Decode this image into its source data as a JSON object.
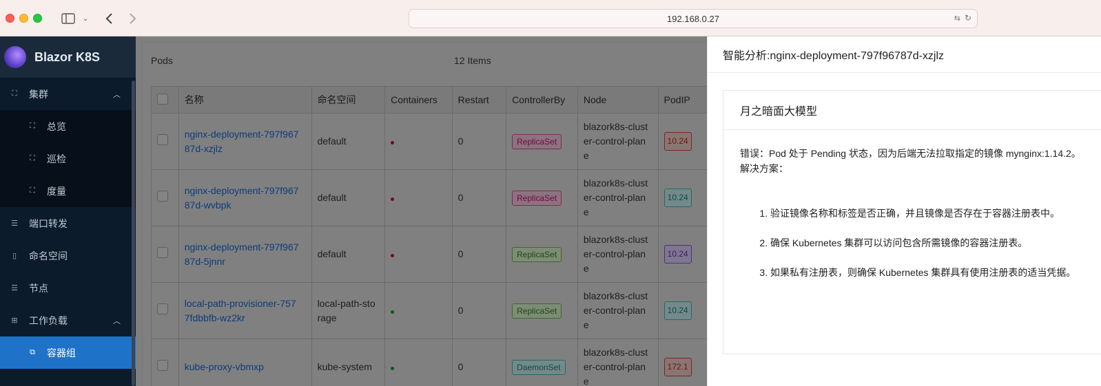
{
  "browser": {
    "url": "192.168.0.27"
  },
  "sidebar": {
    "brand": "Blazor K8S",
    "items": [
      {
        "label": "集群",
        "icon": "cluster-icon",
        "expanded": true
      },
      {
        "label": "总览",
        "icon": "cluster-icon",
        "sub": true
      },
      {
        "label": "巡检",
        "icon": "cluster-icon",
        "sub": true
      },
      {
        "label": "度量",
        "icon": "cluster-icon",
        "sub": true
      },
      {
        "label": "端口转发",
        "icon": "list-icon"
      },
      {
        "label": "命名空间",
        "icon": "document-icon"
      },
      {
        "label": "节点",
        "icon": "list-icon"
      },
      {
        "label": "工作负载",
        "icon": "grid-icon",
        "expanded": true
      },
      {
        "label": "容器组",
        "icon": "copy-icon",
        "sub": true,
        "active": true
      }
    ]
  },
  "main": {
    "title": "Pods",
    "count": "12 Items",
    "columns": [
      "名称",
      "命名空间",
      "Containers",
      "Restart",
      "ControllerBy",
      "Node",
      "PodIP"
    ],
    "rows": [
      {
        "name_l1": "nginx-deployment-797f967",
        "name_l2": "87d-xzjlz",
        "ns_l1": "default",
        "ns_l2": "",
        "status": "red",
        "restart": "0",
        "controller": "ReplicaSet",
        "controller_color": "pink",
        "node_l1": "blazork8s-clust",
        "node_l2": "er-control-plan",
        "node_l3": "e",
        "ip": "10.24",
        "ip_color": "red"
      },
      {
        "name_l1": "nginx-deployment-797f967",
        "name_l2": "87d-wvbpk",
        "ns_l1": "default",
        "ns_l2": "",
        "status": "red",
        "restart": "0",
        "controller": "ReplicaSet",
        "controller_color": "pink",
        "node_l1": "blazork8s-clust",
        "node_l2": "er-control-plan",
        "node_l3": "e",
        "ip": "10.24",
        "ip_color": "cyan"
      },
      {
        "name_l1": "nginx-deployment-797f967",
        "name_l2": "87d-5jnnr",
        "ns_l1": "default",
        "ns_l2": "",
        "status": "red",
        "restart": "0",
        "controller": "ReplicaSet",
        "controller_color": "green",
        "node_l1": "blazork8s-clust",
        "node_l2": "er-control-plan",
        "node_l3": "e",
        "ip": "10.24",
        "ip_color": "purple"
      },
      {
        "name_l1": "local-path-provisioner-757",
        "name_l2": "7fdbbfb-wz2kr",
        "ns_l1": "local-path-sto",
        "ns_l2": "rage",
        "status": "green",
        "restart": "0",
        "controller": "ReplicaSet",
        "controller_color": "green",
        "node_l1": "blazork8s-clust",
        "node_l2": "er-control-plan",
        "node_l3": "e",
        "ip": "10.24",
        "ip_color": "cyan"
      },
      {
        "name_l1": "kube-proxy-vbmxp",
        "name_l2": "",
        "ns_l1": "kube-system",
        "ns_l2": "",
        "status": "green",
        "restart": "0",
        "controller": "DaemonSet",
        "controller_color": "teal",
        "node_l1": "blazork8s-clust",
        "node_l2": "er-control-plan",
        "node_l3": "e",
        "ip": "172.1",
        "ip_color": "red"
      }
    ]
  },
  "drawer": {
    "title": "智能分析:nginx-deployment-797f96787d-xzjlz",
    "panel_title": "月之暗面大模型",
    "error_text": "错误：Pod 处于 Pending 状态，因为后端无法拉取指定的镜像 mynginx:1.14.2。",
    "solution_label": "解决方案：",
    "steps": [
      "验证镜像名称和标签是否正确，并且镜像是否存在于容器注册表中。",
      "确保 Kubernetes 集群可以访问包含所需镜像的容器注册表。",
      "如果私有注册表，则确保 Kubernetes 集群具有使用注册表的适当凭据。"
    ]
  }
}
